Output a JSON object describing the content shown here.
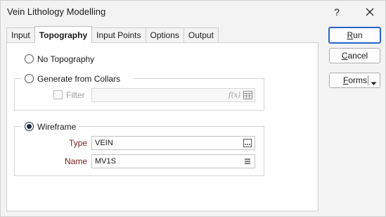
{
  "window": {
    "title": "Vein Lithology Modelling",
    "help_label": "?"
  },
  "tabs": [
    {
      "label": "Input"
    },
    {
      "label": "Topography"
    },
    {
      "label": "Input Points"
    },
    {
      "label": "Options"
    },
    {
      "label": "Output"
    }
  ],
  "active_tab": "Topography",
  "topography": {
    "no_topography_label": "No Topography",
    "generate_from_collars_label": "Generate from Collars",
    "filter_label": "Filter",
    "filter_value": "",
    "filter_fx_symbol": "f(x)",
    "wireframe_label": "Wireframe",
    "selected_option": "Wireframe",
    "type_label": "Type",
    "type_value": "VEIN",
    "name_label": "Name",
    "name_value": "MV1S"
  },
  "buttons": {
    "run": {
      "first": "R",
      "rest": "un"
    },
    "cancel": {
      "first": "C",
      "rest": "ancel"
    },
    "forms": {
      "first": "F",
      "rest": "orms"
    }
  },
  "colors": {
    "accent": "#2a64c5",
    "label_red": "#7a1c1c",
    "radio_fill": "#1f2a44"
  }
}
